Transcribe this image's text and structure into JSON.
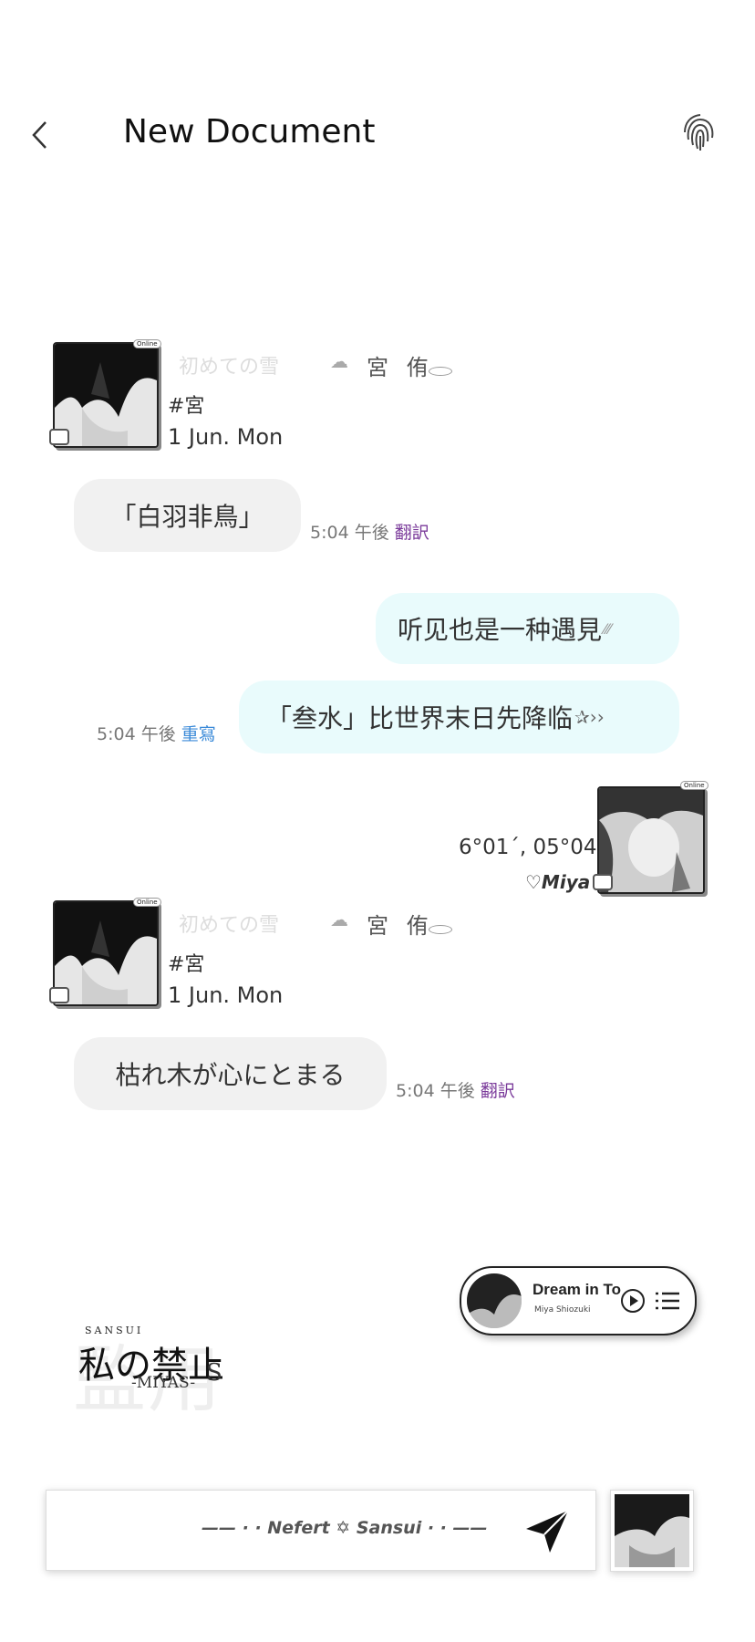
{
  "header": {
    "title": "New Document",
    "back_icon": "chevron-left-icon",
    "right_icon": "fingerprint-icon"
  },
  "messages": [
    {
      "sender": {
        "online_badge": "Online",
        "deco_text": "初めての雪",
        "name": "宮 侑",
        "tag": "#宮",
        "date": "1 Jun. Mon"
      },
      "text": "「白羽非鳥」",
      "time": "5:04 午後",
      "action": "翻訳"
    },
    {
      "outgoing": true,
      "bubbles": [
        {
          "text": "听见也是一种遇見"
        },
        {
          "text": "「叁水」比世界末日先降临"
        }
      ],
      "time": "5:04 午後",
      "action": "重寫"
    },
    {
      "self_card": {
        "online_badge": "Online",
        "coords": "6°01´, 05°04",
        "name": "♡Miya"
      }
    },
    {
      "sender": {
        "online_badge": "Online",
        "deco_text": "初めての雪",
        "name": "宮 侑",
        "tag": "#宮",
        "date": "1 Jun. Mon"
      },
      "text": "枯れ木が心にとまる",
      "time": "5:04 午後",
      "action": "翻訳"
    }
  ],
  "music_widget": {
    "song": "Dream in To",
    "artist": "Miya Shiozuki"
  },
  "logo": {
    "background_text": "監用",
    "top_text": "SANSUI",
    "main_text": "私の禁止",
    "sub_text": "-MIYAS-",
    "side_text": "S"
  },
  "composer": {
    "placeholder": "—— · · Nefert ✡ Sansui · · ——"
  },
  "colors": {
    "incoming_bubble": "#f1f1f1",
    "outgoing_bubble": "#e9fbfc",
    "translate_action": "#7a3a9a",
    "rewrite_action": "#3a8ad8"
  }
}
